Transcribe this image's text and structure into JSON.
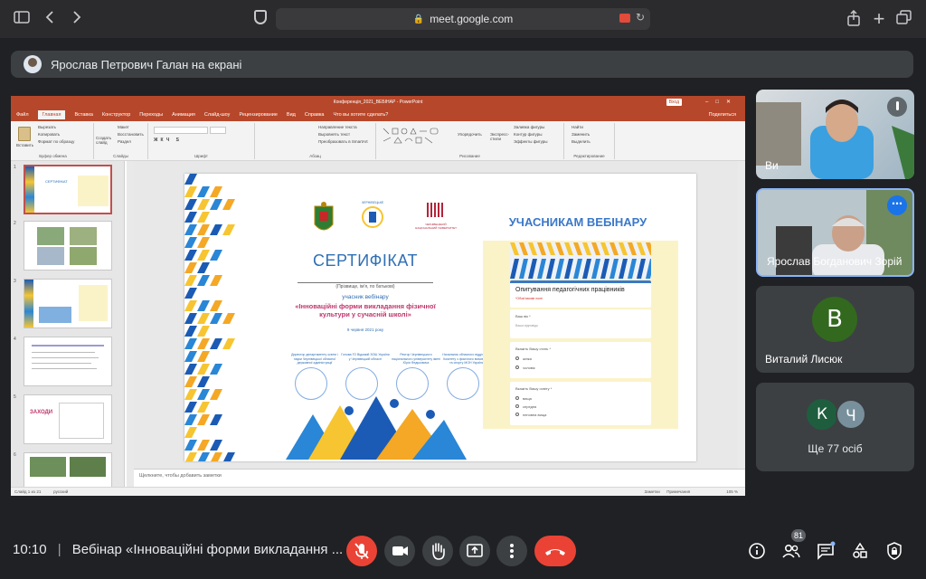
{
  "browser": {
    "url": "meet.google.com"
  },
  "meeting": {
    "presenting_text": "Ярослав Петрович Галан на екрані",
    "time": "10:10",
    "separator": "|",
    "meeting_title": "Вебінар «Інноваційні форми викладання ...",
    "participants_count": "81"
  },
  "powerpoint": {
    "title": "Конференція_2021_ВЕБІНАР - PowerPoint",
    "signin": "Вход",
    "tabs": [
      "Файл",
      "Главная",
      "Вставка",
      "Конструктор",
      "Переходы",
      "Анимация",
      "Слайд-шоу",
      "Рецензирование",
      "Вид",
      "Справка",
      "Что вы хотите сделать?"
    ],
    "active_tab": "Главная",
    "share_label": "Поделиться",
    "ribbon": {
      "paste": "Вставить",
      "cut": "Вырезать",
      "copy": "Копировать",
      "format_painter": "Формат по образцу",
      "clipboard_group": "Буфер обмена",
      "new_slide": "Создать слайд",
      "layout": "Макет",
      "reset": "Восстановить",
      "section": "Раздел",
      "slides_group": "Слайды",
      "font_group": "Шрифт",
      "paragraph_group": "Абзац",
      "text_direction": "Направление текста",
      "align_text": "Выровнять текст",
      "smartart": "Преобразовать в SmartArt",
      "drawing_group": "Рисование",
      "arrange": "Упорядочить",
      "quick_styles": "Экспресс-стили",
      "shape_fill": "Заливка фигуры",
      "shape_outline": "Контур фигуры",
      "shape_effects": "Эффекты фигуры",
      "find": "Найти",
      "replace": "Заменить",
      "select": "Выделить",
      "editing_group": "Редактирование"
    },
    "thumb_numbers": [
      "1",
      "2",
      "3",
      "4",
      "5",
      "6"
    ],
    "thumb5_label": "ЗАХОДИ",
    "notes_placeholder": "Щелкните, чтобы добавить заметки",
    "status": {
      "slide_info": "Слайд 1 из 21",
      "language": "русский",
      "notes": "Заметки",
      "comments": "Примечания",
      "zoom": "105 %"
    }
  },
  "slide": {
    "cert_title": "СЕРТИФІКАТ",
    "name_hint": "(Прізвище, ім'я, по батькові)",
    "role": "учасник вебінару",
    "topic": "«Інноваційні форми викладання фізичної культури у сучасній школі»",
    "date": "9 червня 2021 року",
    "signatories": [
      "Директор департаменту освіти і науки Чернівецької обласної державної адміністрації",
      "Голова ГО Відомий ЗОШ України у Чернівецькій області",
      "Ректор Чернівецького національного університету імені Юрія Федьковича",
      "Начальник обласного відділення Комітету з фізичного виховання та спорту МОН України"
    ],
    "logo_city": "ЧЕРНІВЕЦЬКЕ",
    "logo_univ": "ЧЕРНІВЕЦЬКИЙ НАЦІОНАЛЬНИЙ УНІВЕРСИТЕТ",
    "webinar_heading": "УЧАСНИКАМ ВЕБІНАРУ",
    "form": {
      "title": "Опитування педагогічних працівників",
      "required_note": "*Обов'язкове поле",
      "q1": "Ваш вік *",
      "q1_placeholder": "Ваша відповідь",
      "q2": "Вкажіть Вашу стать *",
      "q2_options": [
        "жінка",
        "чоловік"
      ],
      "q3": "Вкажіть Вашу освіту *",
      "q3_options": [
        "вища",
        "середня",
        "неповна вища"
      ]
    }
  },
  "participants": [
    {
      "name": "Ви",
      "muted": true
    },
    {
      "name": "Ярослав Богданович Зорій"
    },
    {
      "name": "Виталий Лисюк",
      "initial": "В",
      "color": "#33691e"
    }
  ],
  "others": {
    "initials": [
      "К",
      "Ч"
    ],
    "colors": [
      "#1e5e3e",
      "#78909c"
    ],
    "label": "Ще 77 осіб"
  },
  "colors": {
    "meet_bg": "#202124",
    "end_call": "#ea4335",
    "ppt_accent": "#b7472a",
    "cert_blue": "#2f6fb4"
  }
}
